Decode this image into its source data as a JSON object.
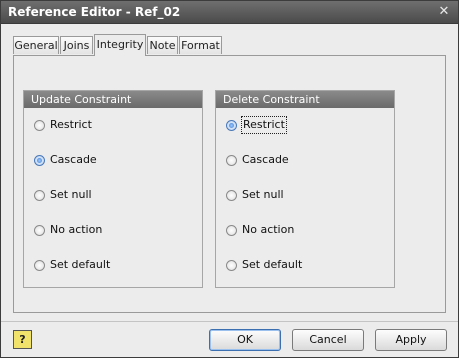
{
  "window": {
    "title": "Reference Editor - Ref_02",
    "close_glyph": "✕"
  },
  "tabs": [
    {
      "label": "General",
      "active": false
    },
    {
      "label": "Joins",
      "active": false
    },
    {
      "label": "Integrity",
      "active": true
    },
    {
      "label": "Note",
      "active": false
    },
    {
      "label": "Format",
      "active": false
    }
  ],
  "update_constraint": {
    "title": "Update Constraint",
    "options": [
      "Restrict",
      "Cascade",
      "Set null",
      "No action",
      "Set default"
    ],
    "selected": "Cascade"
  },
  "delete_constraint": {
    "title": "Delete Constraint",
    "options": [
      "Restrict",
      "Cascade",
      "Set null",
      "No action",
      "Set default"
    ],
    "selected": "Restrict"
  },
  "footer": {
    "help_label": "?",
    "ok_label": "OK",
    "cancel_label": "Cancel",
    "apply_label": "Apply"
  }
}
